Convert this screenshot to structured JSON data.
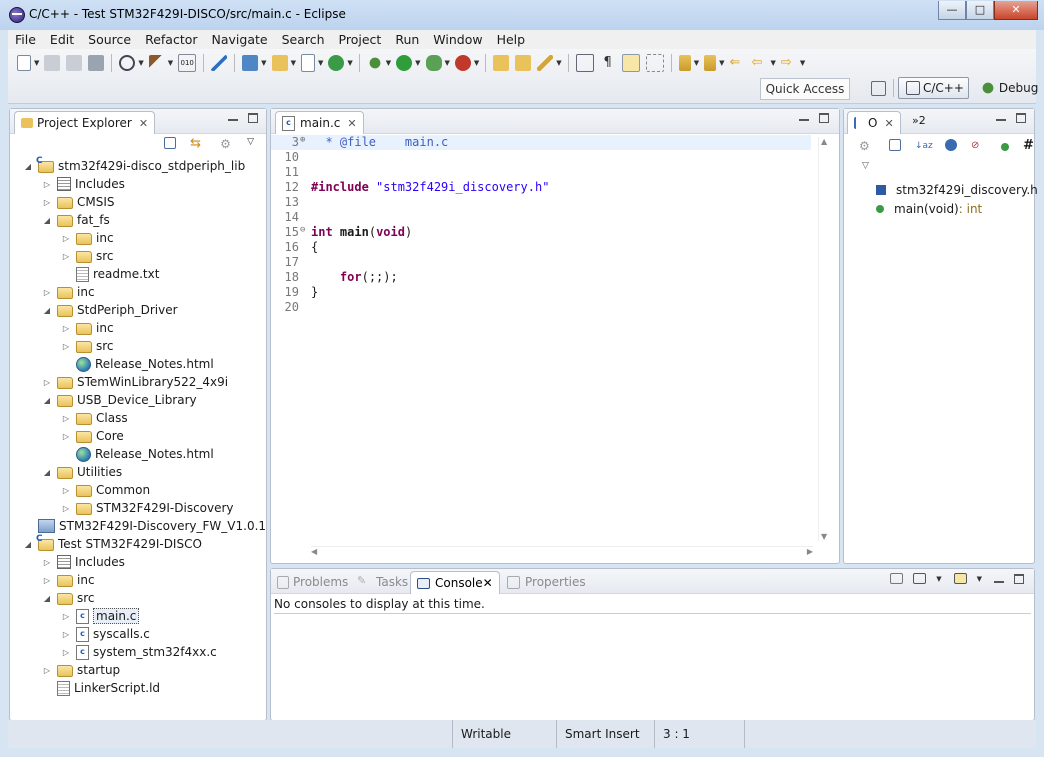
{
  "window": {
    "title": "C/C++ - Test STM32F429I-DISCO/src/main.c - Eclipse",
    "controls": {
      "minimize": "—",
      "maximize": "□",
      "close": "✕"
    }
  },
  "menu": [
    "File",
    "Edit",
    "Source",
    "Refactor",
    "Navigate",
    "Search",
    "Project",
    "Run",
    "Window",
    "Help"
  ],
  "toolbar": {
    "quick_access": "Quick Access",
    "perspectives": [
      {
        "label": "C/C++",
        "active": true
      },
      {
        "label": "Debug",
        "active": false
      }
    ]
  },
  "project_explorer": {
    "tab_label": "Project Explorer",
    "tree": [
      {
        "label": "stm32f429i-disco_stdperiph_lib",
        "icon": "project",
        "depth": 0,
        "state": "expanded"
      },
      {
        "label": "Includes",
        "icon": "includes",
        "depth": 1,
        "state": "collapsed"
      },
      {
        "label": "CMSIS",
        "icon": "folder",
        "depth": 1,
        "state": "collapsed"
      },
      {
        "label": "fat_fs",
        "icon": "folder",
        "depth": 1,
        "state": "expanded"
      },
      {
        "label": "inc",
        "icon": "folder",
        "depth": 2,
        "state": "collapsed"
      },
      {
        "label": "src",
        "icon": "folder",
        "depth": 2,
        "state": "collapsed"
      },
      {
        "label": "readme.txt",
        "icon": "text-file",
        "depth": 2,
        "state": "leaf"
      },
      {
        "label": "inc",
        "icon": "folder",
        "depth": 1,
        "state": "collapsed"
      },
      {
        "label": "StdPeriph_Driver",
        "icon": "folder",
        "depth": 1,
        "state": "expanded"
      },
      {
        "label": "inc",
        "icon": "folder",
        "depth": 2,
        "state": "collapsed"
      },
      {
        "label": "src",
        "icon": "folder",
        "depth": 2,
        "state": "collapsed"
      },
      {
        "label": "Release_Notes.html",
        "icon": "html-file",
        "depth": 2,
        "state": "leaf"
      },
      {
        "label": "STemWinLibrary522_4x9i",
        "icon": "folder",
        "depth": 1,
        "state": "collapsed"
      },
      {
        "label": "USB_Device_Library",
        "icon": "folder",
        "depth": 1,
        "state": "expanded"
      },
      {
        "label": "Class",
        "icon": "folder",
        "depth": 2,
        "state": "collapsed"
      },
      {
        "label": "Core",
        "icon": "folder",
        "depth": 2,
        "state": "collapsed"
      },
      {
        "label": "Release_Notes.html",
        "icon": "html-file",
        "depth": 2,
        "state": "leaf"
      },
      {
        "label": "Utilities",
        "icon": "folder",
        "depth": 1,
        "state": "expanded"
      },
      {
        "label": "Common",
        "icon": "folder",
        "depth": 2,
        "state": "collapsed"
      },
      {
        "label": "STM32F429I-Discovery",
        "icon": "folder",
        "depth": 2,
        "state": "collapsed"
      },
      {
        "label": "STM32F429I-Discovery_FW_V1.0.1",
        "icon": "closed-project",
        "depth": 0,
        "state": "leaf"
      },
      {
        "label": "Test STM32F429I-DISCO",
        "icon": "project",
        "depth": 0,
        "state": "expanded"
      },
      {
        "label": "Includes",
        "icon": "includes",
        "depth": 1,
        "state": "collapsed"
      },
      {
        "label": "inc",
        "icon": "folder",
        "depth": 1,
        "state": "collapsed"
      },
      {
        "label": "src",
        "icon": "folder",
        "depth": 1,
        "state": "expanded"
      },
      {
        "label": "main.c",
        "icon": "c-file",
        "depth": 2,
        "state": "collapsed",
        "selected": true
      },
      {
        "label": "syscalls.c",
        "icon": "c-file",
        "depth": 2,
        "state": "collapsed"
      },
      {
        "label": "system_stm32f4xx.c",
        "icon": "c-file",
        "depth": 2,
        "state": "collapsed"
      },
      {
        "label": "startup",
        "icon": "folder",
        "depth": 1,
        "state": "collapsed"
      },
      {
        "label": "LinkerScript.ld",
        "icon": "text-file",
        "depth": 1,
        "state": "leaf"
      }
    ]
  },
  "editor": {
    "tab_label": "main.c",
    "lines": [
      {
        "num": "3",
        "marker": "⊕",
        "text": "  * @file    main.c",
        "kind": "doc",
        "highlight": true
      },
      {
        "num": "10",
        "marker": "",
        "text": "",
        "kind": "plain"
      },
      {
        "num": "11",
        "marker": "",
        "text": "",
        "kind": "plain"
      },
      {
        "num": "12",
        "marker": "",
        "text": "#include \"stm32f429i_discovery.h\"",
        "kind": "include"
      },
      {
        "num": "13",
        "marker": "",
        "text": "",
        "kind": "plain"
      },
      {
        "num": "14",
        "marker": "",
        "text": "",
        "kind": "plain"
      },
      {
        "num": "15",
        "marker": "⊖",
        "text": "int main(void)",
        "kind": "func"
      },
      {
        "num": "16",
        "marker": "",
        "text": "{",
        "kind": "plain"
      },
      {
        "num": "17",
        "marker": "",
        "text": "",
        "kind": "plain"
      },
      {
        "num": "18",
        "marker": "",
        "text": "    for(;;);",
        "kind": "for"
      },
      {
        "num": "19",
        "marker": "",
        "text": "}",
        "kind": "plain"
      },
      {
        "num": "20",
        "marker": "",
        "text": "",
        "kind": "plain"
      }
    ]
  },
  "outline": {
    "tab_label": "O",
    "overflow_label": "»2",
    "items": [
      {
        "name": "stm32f429i_discovery.h",
        "type": "",
        "icon": "include-icon"
      },
      {
        "name": "main(void)",
        "type": " : int",
        "icon": "function-icon"
      }
    ]
  },
  "bottom_panel": {
    "tabs": [
      {
        "label": "Problems",
        "active": false
      },
      {
        "label": "Tasks",
        "active": false
      },
      {
        "label": "Console",
        "active": true
      },
      {
        "label": "Properties",
        "active": false
      }
    ],
    "message": "No consoles to display at this time."
  },
  "statusbar": {
    "writable": "Writable",
    "insert_mode": "Smart Insert",
    "position": "3 : 1"
  },
  "colors": {
    "keyword": "#7f0055",
    "string": "#2a00ff",
    "doc_comment": "#3f5fbf",
    "current_line": "#e8f2fe"
  }
}
